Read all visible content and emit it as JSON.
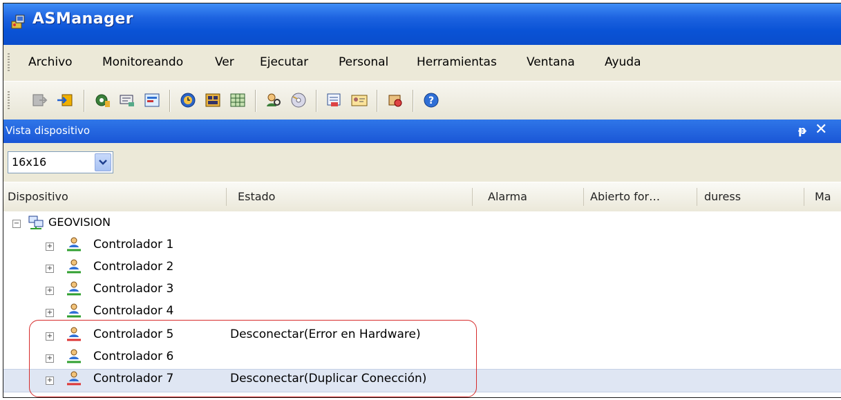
{
  "window": {
    "title": "ASManager"
  },
  "menu": [
    "Archivo",
    "Monitoreando",
    "Ver",
    "Ejecutar",
    "Personal",
    "Herramientas",
    "Ventana",
    "Ayuda"
  ],
  "panel": {
    "title": "Vista dispositivo",
    "pin": "ᵽ",
    "close": "✕"
  },
  "size_selector": {
    "value": "16x16"
  },
  "columns": [
    "Dispositivo",
    "Estado",
    "Alarma",
    "Abierto for…",
    "duress",
    "Ma"
  ],
  "tree": {
    "root": "GEOVISION",
    "expander_collapsed": "+",
    "expander_expanded": "−",
    "controllers": [
      {
        "name": "Controlador 1",
        "status": ""
      },
      {
        "name": "Controlador 2",
        "status": ""
      },
      {
        "name": "Controlador 3",
        "status": ""
      },
      {
        "name": "Controlador 4",
        "status": ""
      },
      {
        "name": "Controlador 5",
        "status": "Desconectar(Error en Hardware)"
      },
      {
        "name": "Controlador 6",
        "status": ""
      },
      {
        "name": "Controlador 7",
        "status": "Desconectar(Duplicar Conección)"
      }
    ]
  },
  "colors": {
    "titlebar": "#0a53d6",
    "highlight": "#d62a2a",
    "selected_row": "#dfe6f3"
  }
}
